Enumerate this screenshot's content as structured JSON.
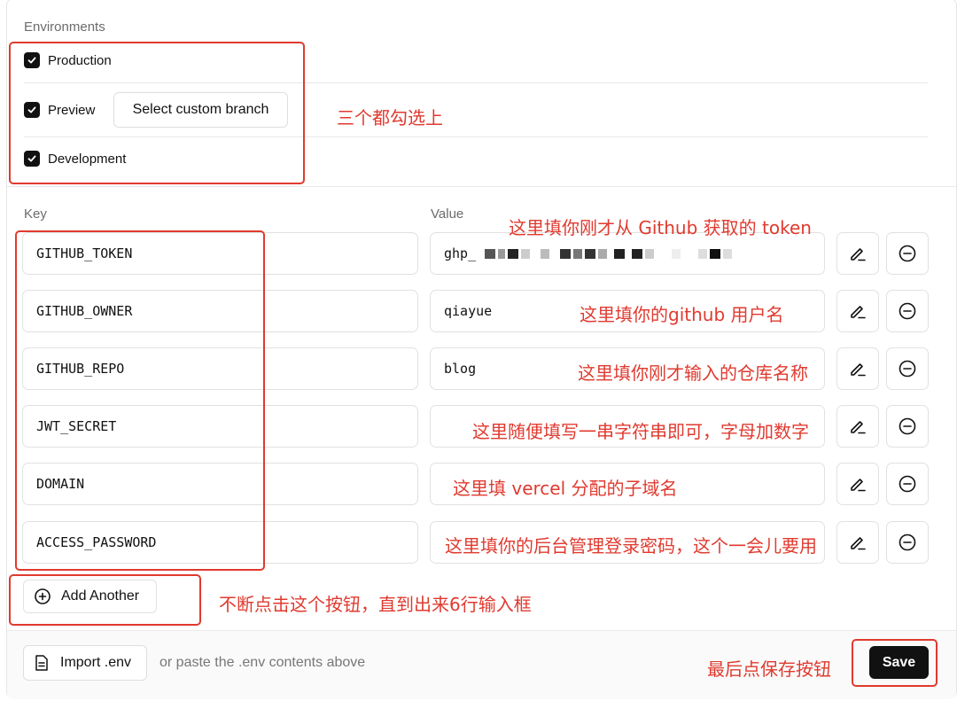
{
  "environments": {
    "label": "Environments",
    "options": [
      {
        "label": "Production",
        "checked": true
      },
      {
        "label": "Preview",
        "checked": true
      },
      {
        "label": "Development",
        "checked": true
      }
    ],
    "custom_branch_button": "Select custom branch"
  },
  "columns": {
    "key": "Key",
    "value": "Value"
  },
  "env_vars": [
    {
      "key": "GITHUB_TOKEN",
      "value": "ghp_"
    },
    {
      "key": "GITHUB_OWNER",
      "value": "qiayue"
    },
    {
      "key": "GITHUB_REPO",
      "value": "blog"
    },
    {
      "key": "JWT_SECRET",
      "value": ""
    },
    {
      "key": "DOMAIN",
      "value": ""
    },
    {
      "key": "ACCESS_PASSWORD",
      "value": ""
    }
  ],
  "add_button": "Add Another",
  "footer": {
    "import_button": "Import .env",
    "paste_hint": "or paste the .env contents above",
    "save_button": "Save"
  },
  "annotations": {
    "check_all": "三个都勾选上",
    "token": "这里填你刚才从 Github 获取的 token",
    "owner": "这里填你的github 用户名",
    "repo": "这里填你刚才输入的仓库名称",
    "jwt": "这里随便填写一串字符串即可，字母加数字",
    "domain": "这里填 vercel 分配的子域名",
    "password": "这里填你的后台管理登录密码，这个一会儿要用",
    "add_another": "不断点击这个按钮，直到出来6行输入框",
    "save": "最后点保存按钮"
  },
  "colors": {
    "annotation": "#e03a2f",
    "primary_button": "#111111",
    "checkbox": "#111111"
  },
  "icons": [
    "check-icon",
    "pencil-icon",
    "minus-circle-icon",
    "plus-circle-icon",
    "file-icon"
  ]
}
